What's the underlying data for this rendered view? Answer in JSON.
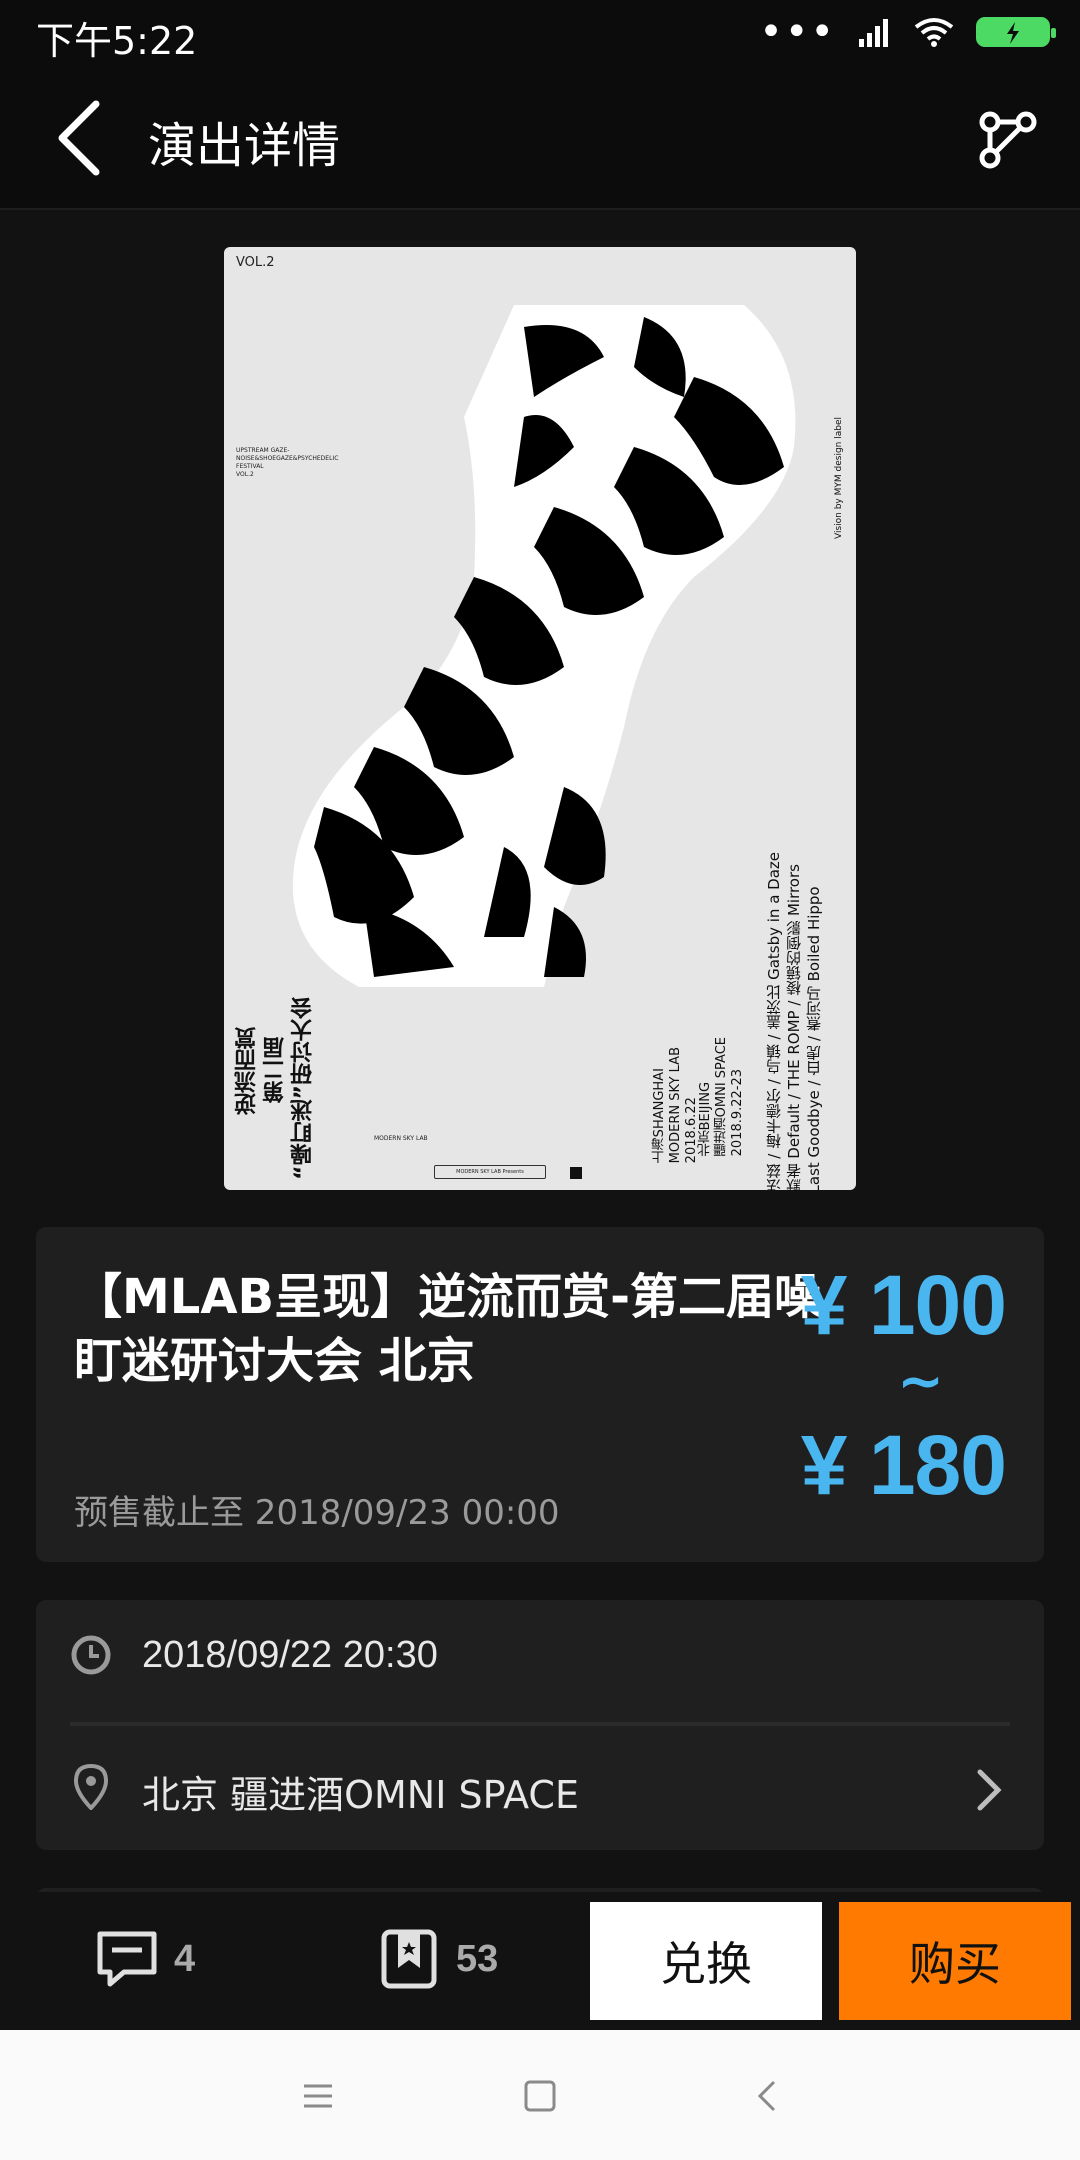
{
  "status_bar": {
    "time": "下午5:22",
    "dots": "•••"
  },
  "header": {
    "title": "演出详情"
  },
  "poster": {
    "vol": "VOL.2",
    "english_block": "UPSTREAM GAZE-\nNOISE&SHOEGAZE&PSYCHEDELIC\nFESTIVAL\nVOL.2",
    "credit": "Vision by MYM design label",
    "cn_vertical_1": "逆流而赏",
    "cn_vertical_2": "第二届",
    "cn_vertical_3": "“噪盯迷”研讨大会",
    "shanghai_vertical": "上海SHANGHAI\nMODERN SKY LAB\n2018.6.22",
    "beijing_vertical": "北京BEIJING\n疆进酒OMNI SPACE\n2018.9.22-23",
    "lineup_vertical": "法兹 / 梅卡德尔 / 乌镇 / 盖茨比 Gatsby in a Daze\n默者 Default / THE ROMP / 棱镜的倒影 Mirrors\nLast Goodbye / 白虎 / 煮河马 Boiled Hippo",
    "logo_text": "MODERN SKY LAB",
    "footer_box": "MODERN SKY LAB Presents"
  },
  "event": {
    "title": "【MLAB呈现】逆流而赏-第二届噪盯迷研讨大会 北京",
    "presale": "预售截止至 2018/09/23 00:00",
    "price_min": "¥ 100",
    "price_tilde": "~",
    "price_max": "¥ 180",
    "time": "2018/09/22 20:30",
    "venue": "北京 疆进酒OMNI SPACE"
  },
  "actions": {
    "comment_count": "4",
    "favorite_count": "53",
    "exchange_label": "兑换",
    "buy_label": "购买"
  },
  "colors": {
    "accent_price": "#4ab6f0",
    "buy_button": "#ff7a00"
  }
}
